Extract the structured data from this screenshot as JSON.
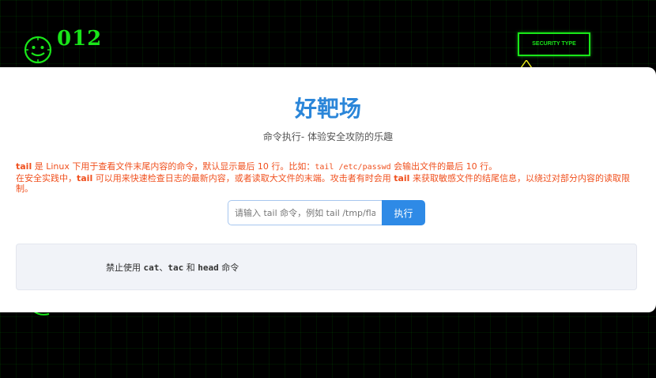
{
  "background": {
    "counter": "012",
    "security_label": "SECURITY TYPE",
    "accent_color": "#19e619",
    "smiley_icon": "smiley-face-icon",
    "warning_icon": "warning-triangle-icon"
  },
  "header": {
    "title": "好靶场",
    "subtitle": "命令执行- 体验安全攻防的乐趣"
  },
  "description": {
    "line1": {
      "cmd": "tail",
      "text_a": " 是 Linux 下用于查看文件末尾内容的命令，默认显示最后 10 行。比如：",
      "example": "tail /etc/passwd",
      "text_b": " 会输出文件的最后 10 行。"
    },
    "line2": {
      "text_a": "在安全实践中，",
      "cmd_a": "tail",
      "text_b": " 可以用来快速检查日志的最新内容，或者读取大文件的末端。攻击者有时会用 ",
      "cmd_b": "tail",
      "text_c": " 来获取敏感文件的结尾信息，以绕过对部分内容的读取限制。"
    },
    "color": "#f0501e"
  },
  "command_form": {
    "placeholder": "请输入 tail 命令，例如 tail /tmp/flag",
    "value": "",
    "button_label": "执行",
    "button_color": "#2e8ae6"
  },
  "result": {
    "prefix": "禁止使用 ",
    "cmd1": "cat",
    "sep1": "、",
    "cmd2": "tac",
    "mid": " 和 ",
    "cmd3": "head",
    "suffix": " 命令"
  }
}
